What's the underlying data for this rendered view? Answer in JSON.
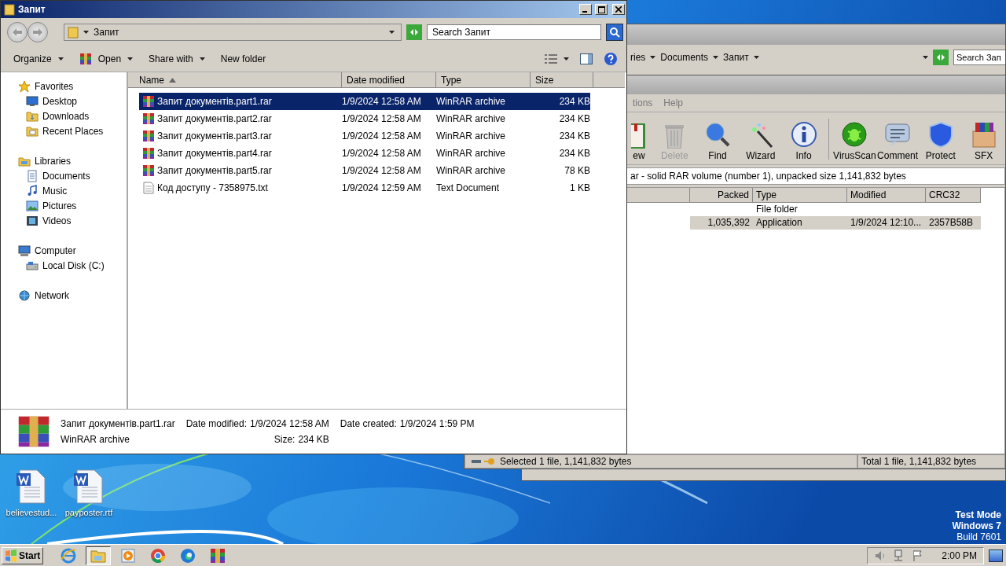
{
  "desktop": {
    "icons": [
      {
        "label": "believestud..."
      },
      {
        "label": "payposter.rtf"
      }
    ],
    "system_text": [
      "Test Mode",
      "Windows 7",
      "Build 7601"
    ]
  },
  "back_explorer": {
    "breadcrumb": [
      "ries",
      "Documents",
      "Запит"
    ],
    "search": {
      "placeholder": "Search Зап"
    }
  },
  "winrar": {
    "menu": [
      "tions",
      "Help"
    ],
    "tools": [
      {
        "label": "ew",
        "kind": "book",
        "disabled": false
      },
      {
        "label": "Delete",
        "kind": "trash",
        "disabled": true
      },
      {
        "label": "Find",
        "kind": "magnifier",
        "disabled": false
      },
      {
        "label": "Wizard",
        "kind": "wand",
        "disabled": false
      },
      {
        "label": "Info",
        "kind": "info",
        "disabled": false
      },
      {
        "label": "VirusScan",
        "kind": "bug",
        "disabled": false
      },
      {
        "label": "Comment",
        "kind": "comment",
        "disabled": false
      },
      {
        "label": "Protect",
        "kind": "shield",
        "disabled": false
      },
      {
        "label": "SFX",
        "kind": "box",
        "disabled": false
      }
    ],
    "info": "ar - solid RAR volume (number 1), unpacked size 1,141,832 bytes",
    "columns": [
      "Packed",
      "Type",
      "Modified",
      "CRC32"
    ],
    "rows": [
      {
        "type": "File folder",
        "selected": false
      },
      {
        "packed": "1,035,392",
        "type": "Application",
        "modified": "1/9/2024 12:10...",
        "crc": "2357B58B",
        "selected": true
      }
    ],
    "status": {
      "selected": "Selected 1 file, 1,141,832 bytes",
      "total": "Total 1 file, 1,141,832 bytes"
    }
  },
  "explorer": {
    "title": "Запит",
    "address": "Запит",
    "search": {
      "placeholder": "Search Запит"
    },
    "commands": [
      {
        "label": "Organize",
        "kind": "menu"
      },
      {
        "label": "Open",
        "kind": "app-menu"
      },
      {
        "label": "Share with",
        "kind": "menu"
      },
      {
        "label": "New folder",
        "kind": "plain"
      }
    ],
    "nav": [
      {
        "label": "Favorites",
        "kind": "star",
        "children": [
          {
            "label": "Desktop",
            "kind": "desktop"
          },
          {
            "label": "Downloads",
            "kind": "folder"
          },
          {
            "label": "Recent Places",
            "kind": "recent"
          }
        ]
      },
      {
        "label": "Libraries",
        "kind": "library",
        "children": [
          {
            "label": "Documents",
            "kind": "documents"
          },
          {
            "label": "Music",
            "kind": "music"
          },
          {
            "label": "Pictures",
            "kind": "pictures"
          },
          {
            "label": "Videos",
            "kind": "videos"
          }
        ]
      },
      {
        "label": "Computer",
        "kind": "computer",
        "children": [
          {
            "label": "Local Disk (C:)",
            "kind": "disk"
          }
        ]
      },
      {
        "label": "Network",
        "kind": "network"
      }
    ],
    "columns": [
      {
        "label": "Name",
        "sorted": true
      },
      {
        "label": "Date modified",
        "sorted": false
      },
      {
        "label": "Type",
        "sorted": false
      },
      {
        "label": "Size",
        "sorted": false
      }
    ],
    "files": [
      {
        "name": "Запит документів.part1.rar",
        "date": "1/9/2024 12:58 AM",
        "type": "WinRAR archive",
        "size": "234 KB",
        "kind": "rar",
        "selected": true
      },
      {
        "name": "Запит документів.part2.rar",
        "date": "1/9/2024 12:58 AM",
        "type": "WinRAR archive",
        "size": "234 KB",
        "kind": "rar",
        "selected": false
      },
      {
        "name": "Запит документів.part3.rar",
        "date": "1/9/2024 12:58 AM",
        "type": "WinRAR archive",
        "size": "234 KB",
        "kind": "rar",
        "selected": false
      },
      {
        "name": "Запит документів.part4.rar",
        "date": "1/9/2024 12:58 AM",
        "type": "WinRAR archive",
        "size": "234 KB",
        "kind": "rar",
        "selected": false
      },
      {
        "name": "Запит документів.part5.rar",
        "date": "1/9/2024 12:58 AM",
        "type": "WinRAR archive",
        "size": "78 KB",
        "kind": "rar",
        "selected": false
      },
      {
        "name": "Код доступу - 7358975.txt",
        "date": "1/9/2024 12:59 AM",
        "type": "Text Document",
        "size": "1 KB",
        "kind": "text",
        "selected": false
      }
    ],
    "details": {
      "name": "Запит документів.part1.rar",
      "type": "WinRAR archive",
      "fields": [
        {
          "label": "Date modified:",
          "value": "1/9/2024 12:58 AM"
        },
        {
          "label": "Size:",
          "value": "234 KB"
        },
        {
          "label": "Date created:",
          "value": "1/9/2024 1:59 PM"
        }
      ]
    }
  },
  "taskbar": {
    "start": "Start",
    "apps": [
      {
        "kind": "ie",
        "active": false
      },
      {
        "kind": "folder",
        "active": true
      },
      {
        "kind": "media",
        "active": false
      },
      {
        "kind": "chrome",
        "active": false
      },
      {
        "kind": "edge",
        "active": false
      },
      {
        "kind": "rar",
        "active": false
      }
    ],
    "tray": [
      {
        "kind": "speaker"
      },
      {
        "kind": "network"
      },
      {
        "kind": "flag"
      }
    ],
    "clock": "2:00 PM"
  }
}
